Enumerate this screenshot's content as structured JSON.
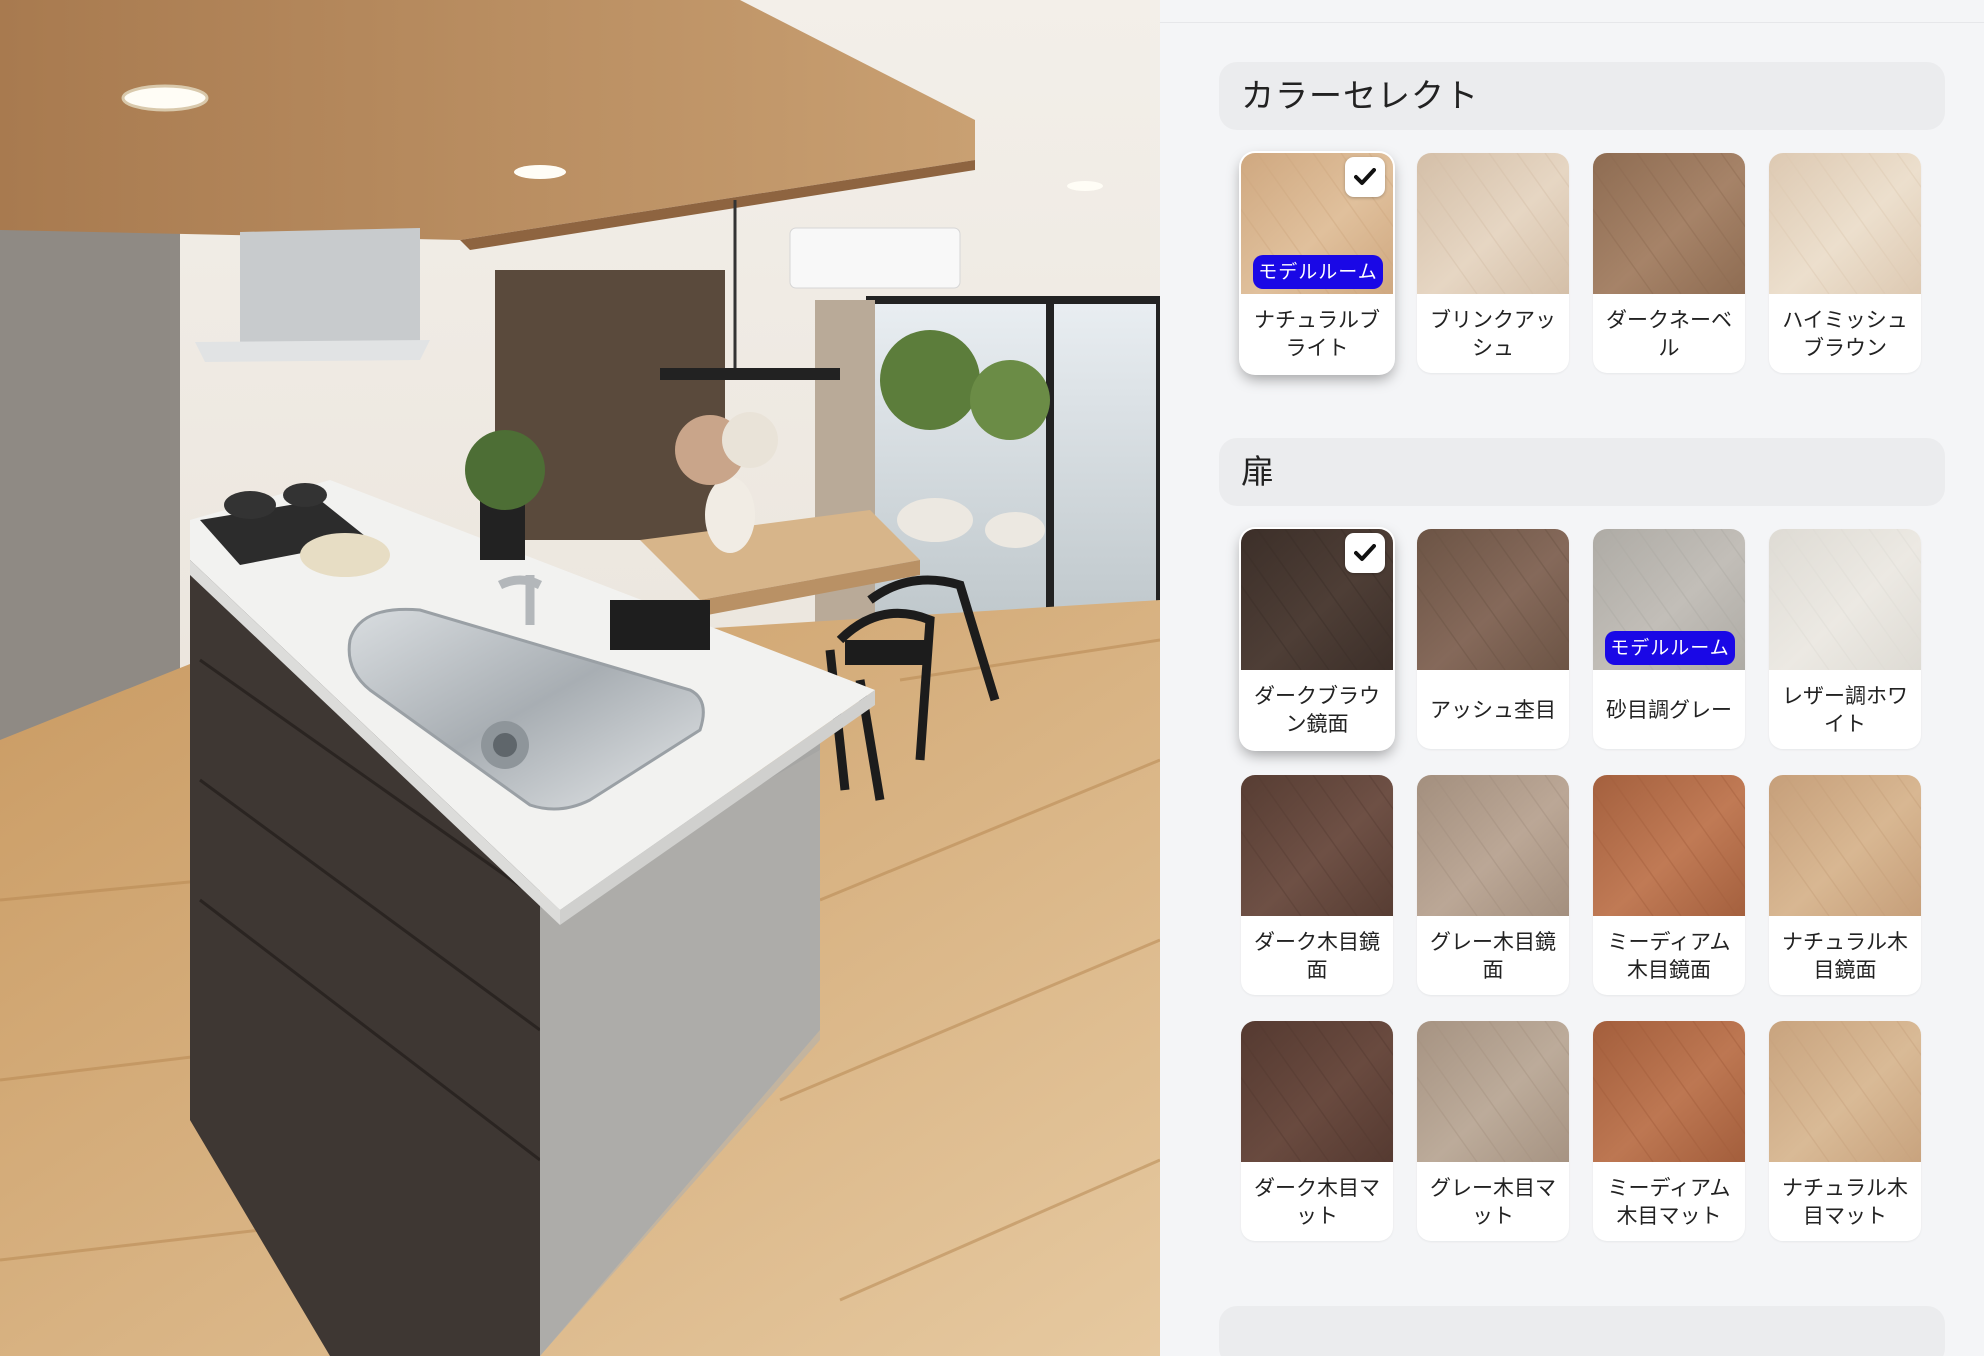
{
  "sections": {
    "color_select": {
      "title": "カラーセレクト",
      "items": [
        {
          "label": "ナチュラルブライト",
          "label_lines": [
            "ナチュラルブ",
            "ライト"
          ],
          "selected": true,
          "badge": "モデルルーム",
          "colors": [
            "#cfa880",
            "#e0c09c"
          ]
        },
        {
          "label": "ブリンクアッシュ",
          "label_lines": [
            "ブリンクアッ",
            "シュ"
          ],
          "selected": false,
          "colors": [
            "#d4bfa8",
            "#e6d6c3"
          ]
        },
        {
          "label": "ダークネーベル",
          "label_lines": [
            "ダークネーベ",
            "ル"
          ],
          "selected": false,
          "colors": [
            "#8e6c52",
            "#a68368"
          ]
        },
        {
          "label": "ハイミッシュブラウン",
          "label_lines": [
            "ハイミッシュ",
            "ブラウン"
          ],
          "selected": false,
          "colors": [
            "#ddc9b2",
            "#ecdfcd"
          ]
        }
      ]
    },
    "door": {
      "title": "扉",
      "items": [
        {
          "label": "ダークブラウン鏡面",
          "label_lines": [
            "ダークブラウ",
            "ン鏡面"
          ],
          "selected": true,
          "colors": [
            "#3c2f29",
            "#4e3e36"
          ]
        },
        {
          "label": "アッシュ杢目",
          "label_lines": [
            "アッシュ杢目"
          ],
          "selected": false,
          "colors": [
            "#6c5445",
            "#85695a"
          ]
        },
        {
          "label": "砂目調グレー",
          "label_lines": [
            "砂目調グレー"
          ],
          "selected": false,
          "badge": "モデルルーム",
          "colors": [
            "#aeaba5",
            "#c2beb8"
          ]
        },
        {
          "label": "レザー調ホワイト",
          "label_lines": [
            "レザー調ホワ",
            "イト"
          ],
          "selected": false,
          "colors": [
            "#dedbd4",
            "#ece9e3"
          ]
        },
        {
          "label": "ダーク木目鏡面",
          "label_lines": [
            "ダーク木目鏡",
            "面"
          ],
          "selected": false,
          "colors": [
            "#573d33",
            "#6e5045"
          ]
        },
        {
          "label": "グレー木目鏡面",
          "label_lines": [
            "グレー木目鏡",
            "面"
          ],
          "selected": false,
          "colors": [
            "#a38f7e",
            "#bba796"
          ]
        },
        {
          "label": "ミーディアム木目鏡面",
          "label_lines": [
            "ミーディアム",
            "木目鏡面"
          ],
          "selected": false,
          "colors": [
            "#a4603e",
            "#c07a55"
          ]
        },
        {
          "label": "ナチュラル木目鏡面",
          "label_lines": [
            "ナチュラル木",
            "目鏡面"
          ],
          "selected": false,
          "colors": [
            "#c69f7a",
            "#d8b792"
          ]
        },
        {
          "label": "ダーク木目マット",
          "label_lines": [
            "ダーク木目マ",
            "ット"
          ],
          "selected": false,
          "colors": [
            "#553a31",
            "#694a3f"
          ]
        },
        {
          "label": "グレー木目マット",
          "label_lines": [
            "グレー木目マ",
            "ット"
          ],
          "selected": false,
          "colors": [
            "#a69382",
            "#bcab9a"
          ]
        },
        {
          "label": "ミーディアム木目マット",
          "label_lines": [
            "ミーディアム",
            "木目マット"
          ],
          "selected": false,
          "colors": [
            "#a35e3c",
            "#bd7752"
          ]
        },
        {
          "label": "ナチュラル木目マット",
          "label_lines": [
            "ナチュラル木",
            "目マット"
          ],
          "selected": false,
          "colors": [
            "#c8a37e",
            "#d9ba96"
          ]
        }
      ]
    }
  },
  "icons": {
    "check": "check-icon"
  },
  "colors": {
    "badge": "#1a08e6",
    "panel_bg": "#f4f5f7",
    "header_bg": "#ebecee"
  }
}
